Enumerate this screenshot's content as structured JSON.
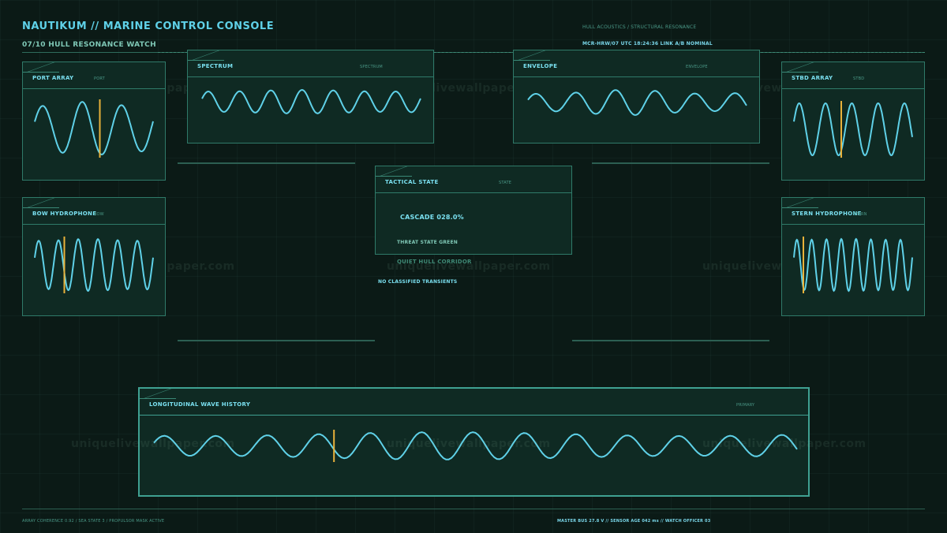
{
  "app": {
    "title": "NAUTIKUM // MARINE CONTROL CONSOLE",
    "subtitle": "07/10  HULL RESONANCE WATCH",
    "header_right_1": "HULL ACOUSTICS / STRUCTURAL RESONANCE",
    "header_right_2": "MCR-HRW/07   UTC 18:24:36   LINK A/B NOMINAL"
  },
  "panels": {
    "port_array": {
      "title": "PORT ARRAY",
      "tag": "PORT"
    },
    "spectrum": {
      "title": "SPECTRUM",
      "tag": "SPECTRUM"
    },
    "envelope": {
      "title": "ENVELOPE",
      "tag": "ENVELOPE"
    },
    "stbd_array": {
      "title": "STBD ARRAY",
      "tag": "STBD"
    },
    "bow_hydrophone": {
      "title": "BOW HYDROPHONE",
      "tag": "BOW"
    },
    "stern_hydrophone": {
      "title": "STERN HYDROPHONE",
      "tag": "STERN"
    },
    "tactical_state": {
      "title": "TACTICAL STATE",
      "tag": "STATE"
    },
    "wave_history": {
      "title": "LONGITUDINAL WAVE HISTORY",
      "tag": "PRIMARY"
    }
  },
  "tactical": {
    "cascade": "CASCADE 028.0%",
    "threat": "THREAT STATE GREEN",
    "corridor": "QUIET HULL CORRIDOR",
    "transients": "NO CLASSIFIED TRANSIENTS"
  },
  "footer": {
    "left": "ARRAY COHERENCE 0.92 / SEA STATE 3 / PROPULSOR MASK ACTIVE",
    "right": "MASTER BUS 27.8 V  //  SENSOR AGE 042 ms  //  WATCH OFFICER 03"
  },
  "watermark": "uniquelivewallpaper.com",
  "colors": {
    "background": "#0b1a16",
    "panel_bg": "#0f2a23",
    "panel_border": "#2f7a69",
    "accent_cyan": "#5fd1e8",
    "marker_amber": "#e8b13a",
    "muted_text": "#4a9887"
  },
  "waveforms": {
    "port_array": {
      "cycles": 3,
      "marker_fraction": 0.55
    },
    "spectrum": {
      "cycles": 7
    },
    "envelope": {
      "cycles": 5.5
    },
    "stbd_array": {
      "cycles": 4.5,
      "marker_fraction": 0.4
    },
    "bow_hydrophone": {
      "cycles": 6,
      "marker_fraction": 0.25
    },
    "stern_hydrophone": {
      "cycles": 8,
      "marker_fraction": 0.08
    },
    "wave_history": {
      "cycles": 12.5,
      "marker_fraction": 0.28
    }
  }
}
